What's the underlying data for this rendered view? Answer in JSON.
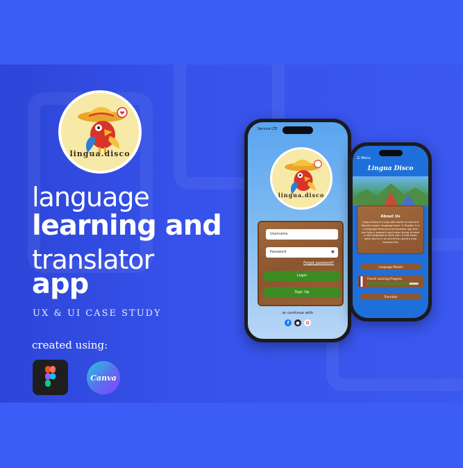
{
  "colors": {
    "background": "#3b5cf6",
    "accent_green": "#3d8b22",
    "wood": "#8a5530",
    "logo_bg": "#f7e9a8"
  },
  "logo": {
    "text": "lingua.disco"
  },
  "headline": {
    "line1": "language",
    "line2": "learning and",
    "line3": "translator",
    "line4": "app"
  },
  "subtitle": "UX & UI CASE STUDY",
  "created_using": "created using:",
  "tools": [
    {
      "name": "figma",
      "icon": "figma-icon"
    },
    {
      "name": "Canva",
      "icon": "canva-icon"
    }
  ],
  "login_phone": {
    "status": "Service  LTE",
    "logo_text": "lingua.disco",
    "username_placeholder": "Username",
    "password_placeholder": "Password",
    "forgot": "Forgot password?",
    "login_label": "Login",
    "signup_label": "Sign Up",
    "continue_text": "or continue with"
  },
  "home_phone": {
    "nav": "☰  Menu",
    "title": "Lingua Disco",
    "about_title": "About Us",
    "about_text": "Lingua Disco is a play with words in Latin but literally means 'language learn' in English. It is a language learning and translator app that can help in people's need when trying to learn a new language on their own. It also helps when you're in an out of the country trips because the",
    "menu_label": "Language Module",
    "progress_label": "French Learning Progress",
    "progress_fraction": 0.82,
    "translator_label": "Translator"
  }
}
